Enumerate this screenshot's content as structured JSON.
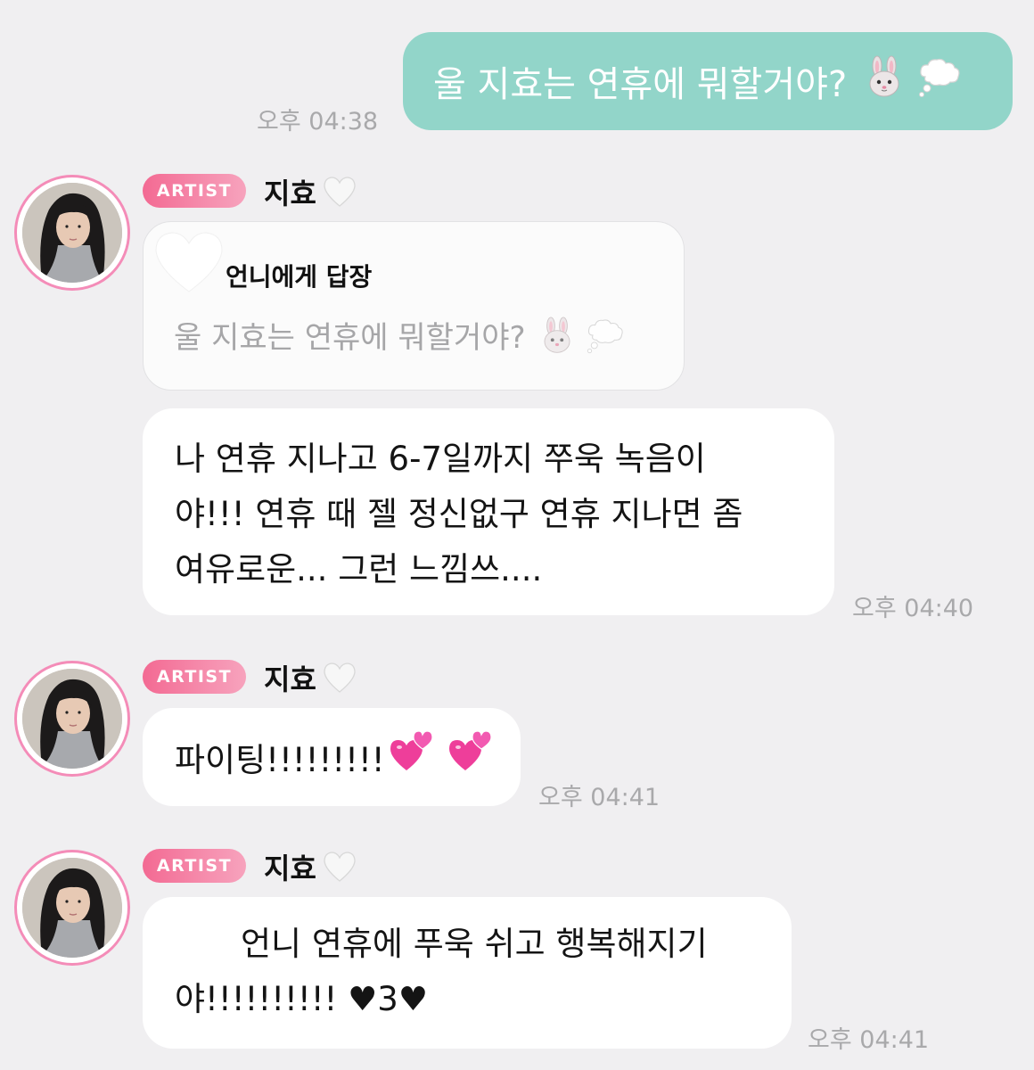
{
  "outgoing": {
    "text": "울 지효는 연휴에 뭐할거야?",
    "emojis": [
      "rabbit-face",
      "thought-balloon"
    ],
    "time": "오후 04:38",
    "bubble_color": "#92d5c9"
  },
  "artist_name": "지효",
  "artist_badge": "ARTIST",
  "badge_color": "#f36a93",
  "messages": [
    {
      "reply": {
        "title": "언니에게 답장",
        "quote": "울 지효는 연휴에 뭐할거야?"
      },
      "lines": [
        "나 연휴 지나고 6-7일까지 쭈욱 녹음이",
        "야!!! 연휴 때 젤 정신없구 연휴 지나면 좀",
        "여유로운... 그런 느낌쓰...."
      ],
      "time": "오후 04:40"
    },
    {
      "lines": [
        "파이팅!!!!!!!!!"
      ],
      "emojis": [
        "two-hearts",
        "two-hearts"
      ],
      "time": "오후 04:41"
    },
    {
      "lines": [
        "언니 연휴에 푸욱 쉬고 행복해지기",
        "야!!!!!!!!!! ♥3♥"
      ],
      "time": "오후 04:41"
    }
  ]
}
